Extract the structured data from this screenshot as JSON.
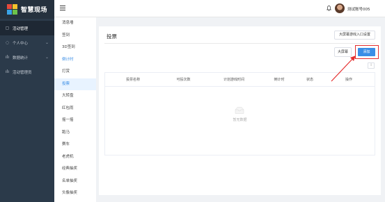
{
  "app": {
    "title": "智慧现场",
    "logo_colors": [
      "#e64a3c",
      "#f4c22b",
      "#3aa4e8",
      "#6cc24a"
    ]
  },
  "sidebar": {
    "items": [
      {
        "label": "活动管理",
        "icon": "document-icon",
        "active": true
      },
      {
        "label": "个人中心",
        "icon": "user-icon",
        "chevron": "⌄"
      },
      {
        "label": "数据统计",
        "icon": "chart-icon",
        "chevron": "⌄"
      },
      {
        "label": "活动管理员",
        "icon": "admin-icon"
      }
    ]
  },
  "topbar": {
    "menu_icon": "hamburger-icon",
    "bell_icon": "bell-icon",
    "username": "测试账号005"
  },
  "submenu": {
    "items": [
      {
        "label": "消息墙",
        "state": "normal"
      },
      {
        "label": "签到",
        "state": "normal"
      },
      {
        "label": "3D签到",
        "state": "normal"
      },
      {
        "label": "倒计时",
        "state": "blue"
      },
      {
        "label": "打赏",
        "state": "normal"
      },
      {
        "label": "投票",
        "state": "active"
      },
      {
        "label": "大转盘",
        "state": "normal"
      },
      {
        "label": "红包雨",
        "state": "normal"
      },
      {
        "label": "摇一摇",
        "state": "normal"
      },
      {
        "label": "跑马",
        "state": "normal"
      },
      {
        "label": "赛车",
        "state": "normal"
      },
      {
        "label": "老虎机",
        "state": "normal"
      },
      {
        "label": "经典抽奖",
        "state": "normal"
      },
      {
        "label": "名单抽奖",
        "state": "normal"
      },
      {
        "label": "头像抽奖",
        "state": "normal"
      }
    ]
  },
  "main": {
    "title": "投票",
    "entry_button": "大屏幕游戏入口设置",
    "big_screen_button": "大屏幕",
    "add_button": "添加",
    "tool_icon": "column-settings-icon",
    "table": {
      "headers": [
        "投票名称",
        "可投次数",
        "计划游戏时间",
        "倒计时",
        "状态",
        "操作"
      ],
      "empty_text": "暂无数据"
    }
  },
  "annotation": {
    "highlight_color": "#e52d2d"
  }
}
